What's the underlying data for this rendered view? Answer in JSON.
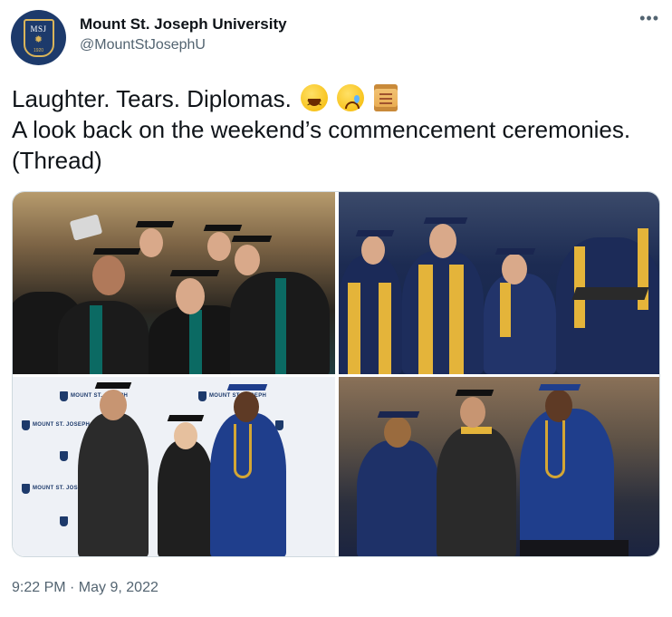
{
  "account": {
    "name": "Mount St. Joseph University",
    "handle": "@MountStJosephU",
    "avatar_text": "MSJ",
    "avatar_year": "1920"
  },
  "menu_icon": "more-horizontal-icon",
  "tweet": {
    "line1": "Laughter. Tears. Diplomas.",
    "line2": "A look back on the weekend’s commencement ceremonies. (Thread)",
    "emojis": [
      "laughing-face-icon",
      "crying-face-icon",
      "scroll-icon"
    ]
  },
  "timestamp": "9:22 PM · May 9, 2022",
  "backdrop_text": "MOUNT ST. JOSEPH",
  "colors": {
    "text": "#0f1419",
    "secondary": "#536471",
    "brand_navy": "#1d3a6b",
    "brand_gold": "#d9b45a"
  }
}
